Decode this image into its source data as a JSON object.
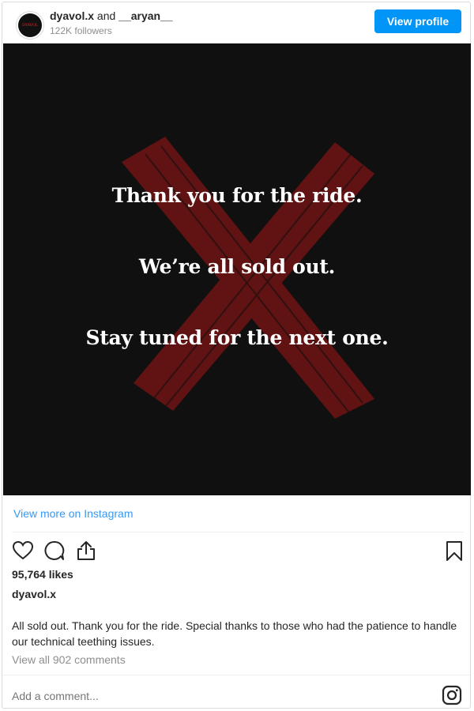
{
  "header": {
    "avatar_text": "DYAVOL",
    "user1": "dyavol.x",
    "conjunction": "and",
    "user2": "__aryan__",
    "followers": "122K followers",
    "view_profile_label": "View profile"
  },
  "post": {
    "line1": "Thank you for the ride.",
    "line2": "We’re all sold out.",
    "line3": "Stay tuned for the next one."
  },
  "view_more_label": "View more on Instagram",
  "actions": {
    "like_icon": "heart-icon",
    "comment_icon": "comment-icon",
    "share_icon": "share-icon",
    "save_icon": "bookmark-icon"
  },
  "likes": "95,764 likes",
  "owner": "dyavol.x",
  "caption": "All sold out. Thank you for the ride. Special thanks to those who had the patience to handle our technical teething issues.",
  "view_comments": "View all 902 comments",
  "comment_placeholder": "Add a comment...",
  "colors": {
    "accent": "#0095f6",
    "link": "#3897f0",
    "x_mark": "#6e1414",
    "post_bg": "#101010"
  }
}
